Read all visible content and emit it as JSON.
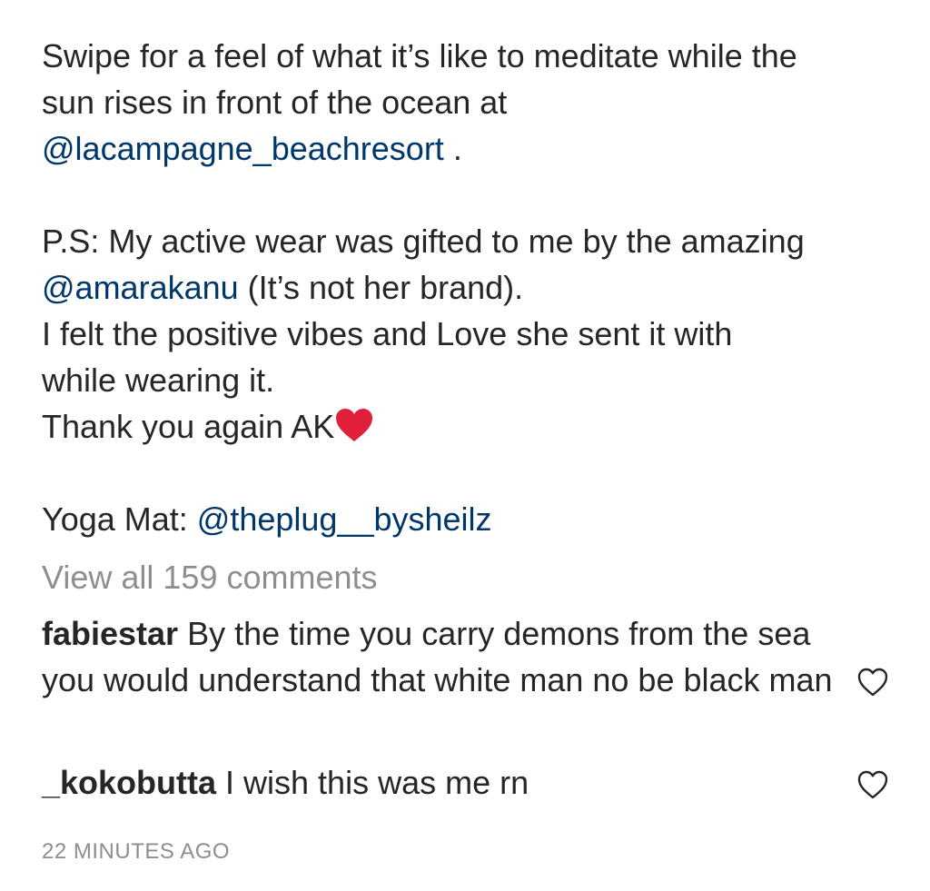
{
  "caption": {
    "line1": "Swipe for a feel of what it’s like to meditate while the",
    "line2": "sun rises in front of the ocean at",
    "mention_resort": "@lacampagne_beachresort",
    "line3_suffix": " .",
    "ps_line": "P.S: My active wear was gifted to me by the amazing",
    "mention_amara": "@amarakanu",
    "amara_suffix": " (It’s not her brand).",
    "vibes_line": "I felt the positive vibes and Love she sent it with",
    "wearing_line": "while wearing it.",
    "thanks_line": "Thank you again AK",
    "thanks_emoji": "red-heart-emoji",
    "yoga_prefix": "Yoga Mat: ",
    "mention_plug": "@theplug__bysheilz"
  },
  "view_all_comments": "View all 159 comments",
  "comments": [
    {
      "username": "fabiestar",
      "text": " By the time you carry demons from the sea you would understand that white man no be black man",
      "like_icon": "heart-outline-icon"
    },
    {
      "username": "_kokobutta",
      "text": " I wish this was me rn",
      "like_icon": "heart-outline-icon"
    }
  ],
  "timestamp": "22 MINUTES AGO",
  "colors": {
    "text": "#262626",
    "mention": "#00376b",
    "muted": "#8e8e8e",
    "heart_emoji": "#e0203a"
  }
}
